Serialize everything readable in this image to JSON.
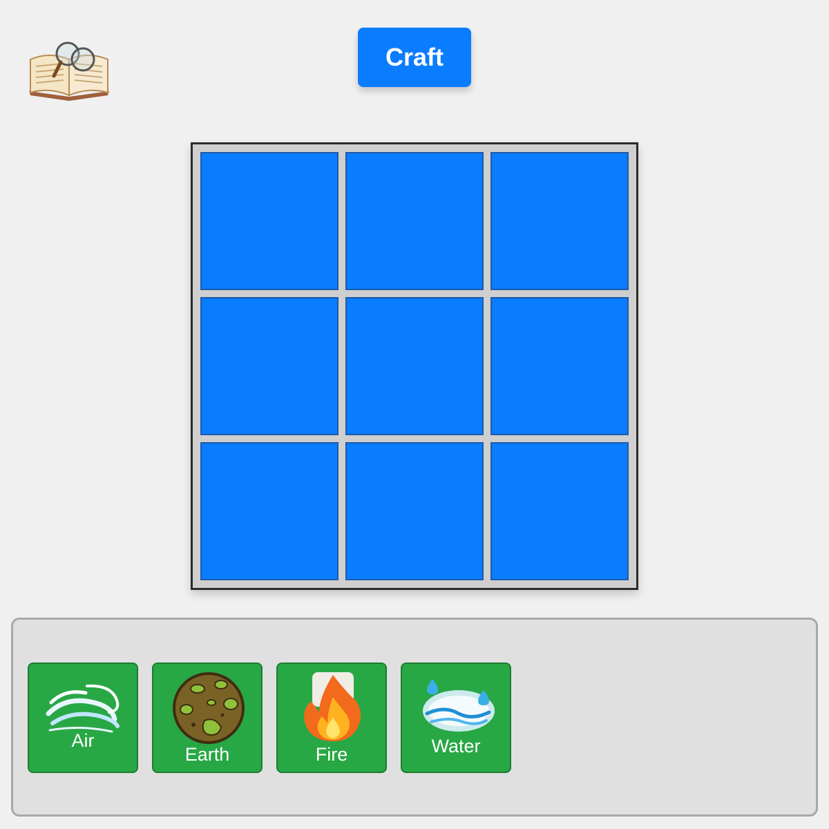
{
  "toolbar": {
    "recipe_book_icon": "book-magnifier-icon",
    "craft_label": "Craft"
  },
  "grid": {
    "rows": 3,
    "cols": 3,
    "cells": [
      "",
      "",
      "",
      "",
      "",
      "",
      "",
      "",
      ""
    ]
  },
  "inventory": {
    "items": [
      {
        "label": "Air",
        "icon": "air-icon"
      },
      {
        "label": "Earth",
        "icon": "earth-icon"
      },
      {
        "label": "Fire",
        "icon": "fire-icon"
      },
      {
        "label": "Water",
        "icon": "water-icon"
      }
    ]
  },
  "colors": {
    "background": "#f0f0f0",
    "accent_blue": "#0a7cff",
    "item_green": "#28a745",
    "grid_frame": "#cfcfcf",
    "inventory_panel": "#e0e0e0"
  }
}
